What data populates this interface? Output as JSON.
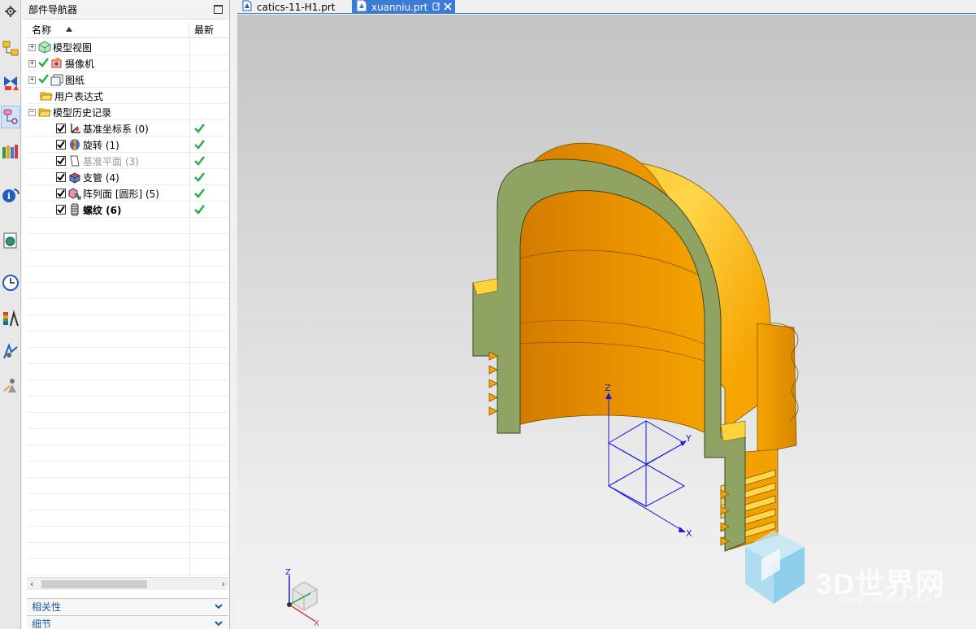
{
  "navigator": {
    "title": "部件导航器",
    "columns": {
      "name": "名称",
      "latest": "最新"
    },
    "nodes": {
      "model_views": "模型视图",
      "cameras": "摄像机",
      "drawings": "图纸",
      "user_expressions": "用户表达式",
      "model_history": "模型历史记录"
    },
    "features": [
      {
        "label": "基准坐标系 (0)",
        "icon": "datum-csys-icon",
        "latest": true,
        "dim": false,
        "bold": false
      },
      {
        "label": "旋转 (1)",
        "icon": "revolve-icon",
        "latest": true,
        "dim": false,
        "bold": false
      },
      {
        "label": "基准平面 (3)",
        "icon": "datum-plane-icon",
        "latest": true,
        "dim": true,
        "bold": false
      },
      {
        "label": "支管 (4)",
        "icon": "boss-icon",
        "latest": true,
        "dim": false,
        "bold": false
      },
      {
        "label": "阵列面 [圆形] (5)",
        "icon": "pattern-face-icon",
        "latest": true,
        "dim": false,
        "bold": false
      },
      {
        "label": "螺纹 (6)",
        "icon": "thread-icon",
        "latest": true,
        "dim": false,
        "bold": true
      }
    ],
    "panels": {
      "dependencies": "相关性",
      "details": "细节"
    }
  },
  "tabs": [
    {
      "label": "catics-11-H1.prt",
      "active": false
    },
    {
      "label": "xuanniu.prt",
      "active": true
    }
  ],
  "viewport": {
    "wcs_axes": {
      "x": "X",
      "y": "Y",
      "z": "Z"
    },
    "triad_axes": {
      "x": "X",
      "z": "Z"
    },
    "watermark_text": "3D世界网",
    "watermark_url": "WWW.3DSJW.COM",
    "colors": {
      "part": "#f5a400",
      "section": "#8fa363",
      "accent": "#3a7bd5",
      "check": "#22b14c"
    }
  },
  "resource_bar_icons": [
    "settings-gear-icon",
    "assembly-navigator-icon",
    "constraint-navigator-icon",
    "part-navigator-icon",
    "reuse-library-icon",
    "info-icon",
    "web-browser-icon",
    "history-clock-icon",
    "palette-icon",
    "process-studio-icon",
    "roles-icon"
  ]
}
